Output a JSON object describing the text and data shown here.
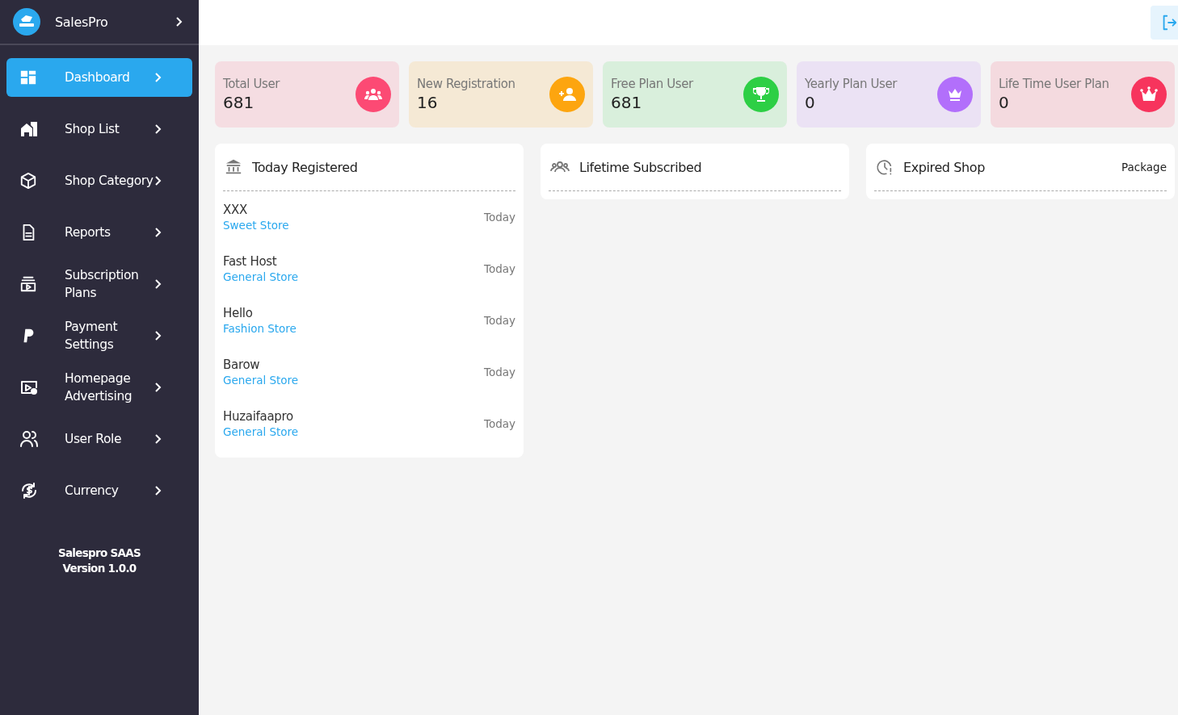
{
  "brand": {
    "name": "SalesPro"
  },
  "nav": [
    {
      "label": "Dashboard",
      "selected": true
    },
    {
      "label": "Shop List",
      "selected": false
    },
    {
      "label": "Shop Category",
      "selected": false
    },
    {
      "label": "Reports",
      "selected": false
    },
    {
      "label": "Subscription Plans",
      "selected": false
    },
    {
      "label": "Payment Settings",
      "selected": false
    },
    {
      "label": "Homepage Advertising",
      "selected": false
    },
    {
      "label": "User Role",
      "selected": false
    },
    {
      "label": "Currency",
      "selected": false
    }
  ],
  "footer": {
    "product": "Salespro SAAS",
    "version": "Version 1.0.0"
  },
  "stats": [
    {
      "label": "Total User",
      "value": "681",
      "color": "#fc4a74"
    },
    {
      "label": "New Registration",
      "value": "16",
      "color": "#fda50f"
    },
    {
      "label": "Free Plan User",
      "value": "681",
      "color": "#2dcf45"
    },
    {
      "label": "Yearly Plan User",
      "value": "0",
      "color": "#b26ffb"
    },
    {
      "label": "Life Time User Plan",
      "value": "0",
      "color": "#f7345d"
    }
  ],
  "panels": [
    {
      "title": "Today Registered",
      "rows": [
        {
          "name": "XXX",
          "category": "Sweet Store",
          "date": "Today"
        },
        {
          "name": "Fast Host",
          "category": "General Store",
          "date": "Today"
        },
        {
          "name": "Hello",
          "category": "Fashion Store",
          "date": "Today"
        },
        {
          "name": "Barow",
          "category": "General Store",
          "date": "Today"
        },
        {
          "name": "Huzaifaapro",
          "category": "General Store",
          "date": "Today"
        }
      ]
    },
    {
      "title": "Lifetime Subscribed"
    },
    {
      "title": "Expired Shop",
      "aside": "Package"
    }
  ]
}
